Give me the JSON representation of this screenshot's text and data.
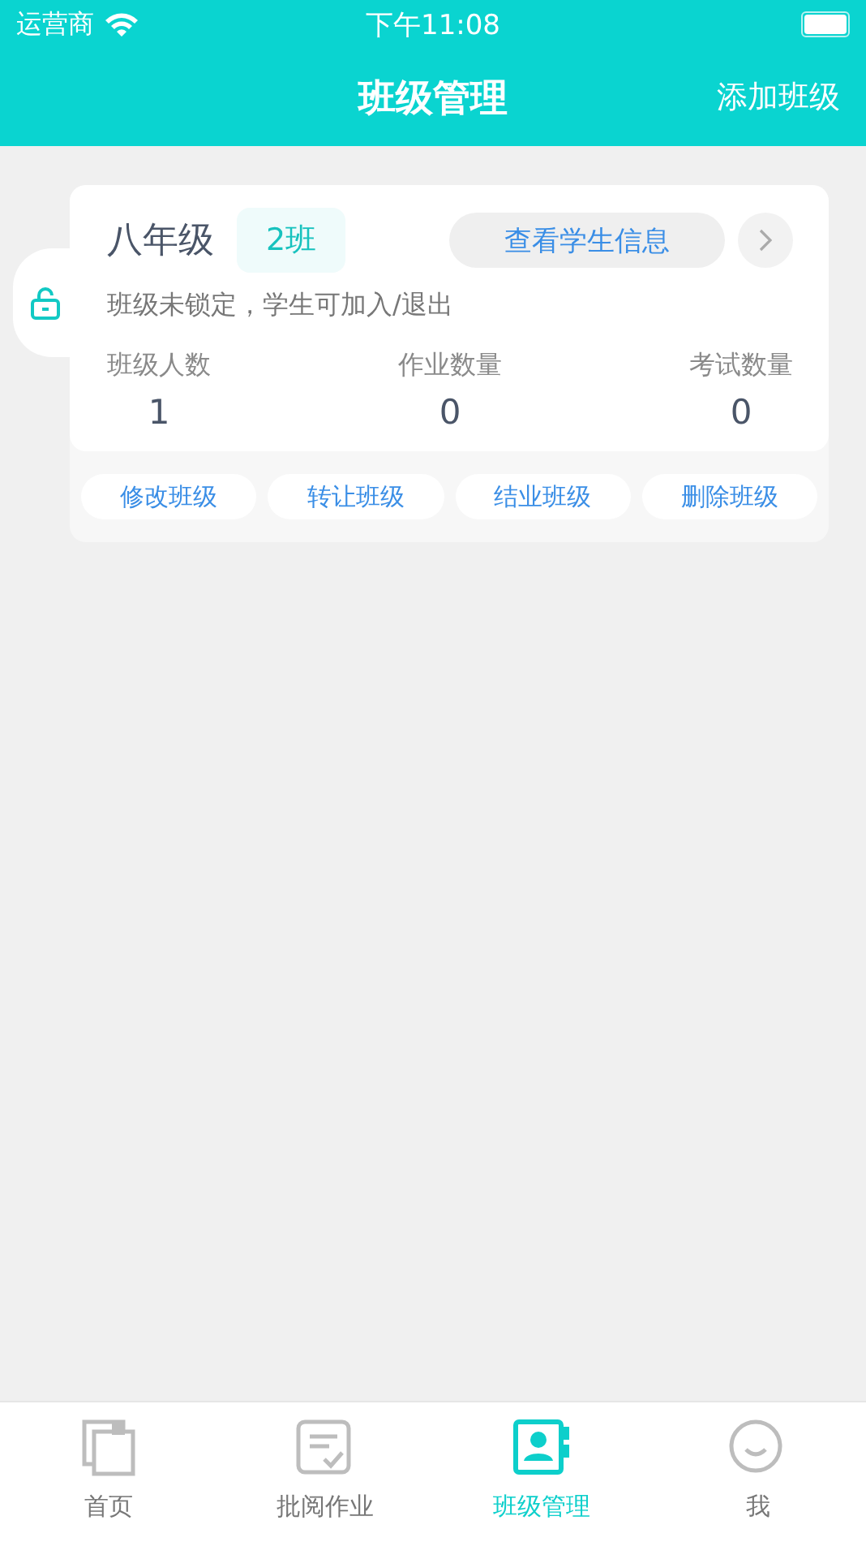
{
  "status_bar": {
    "carrier": "运营商",
    "time": "下午11:08"
  },
  "nav_bar": {
    "title": "班级管理",
    "action": "添加班级"
  },
  "class_card": {
    "grade": "八年级",
    "class_name": "2班",
    "info_button": "查看学生信息",
    "locked": false,
    "lock_note": "班级未锁定，学生可加入/退出",
    "stats": [
      {
        "label": "班级人数",
        "value": "1"
      },
      {
        "label": "作业数量",
        "value": "0"
      },
      {
        "label": "考试数量",
        "value": "0"
      }
    ],
    "actions": [
      "修改班级",
      "转让班级",
      "结业班级",
      "删除班级"
    ]
  },
  "tab_bar": [
    {
      "label": "首页",
      "selected": false
    },
    {
      "label": "批阅作业",
      "selected": false
    },
    {
      "label": "班级管理",
      "selected": true
    },
    {
      "label": "我",
      "selected": false
    }
  ]
}
